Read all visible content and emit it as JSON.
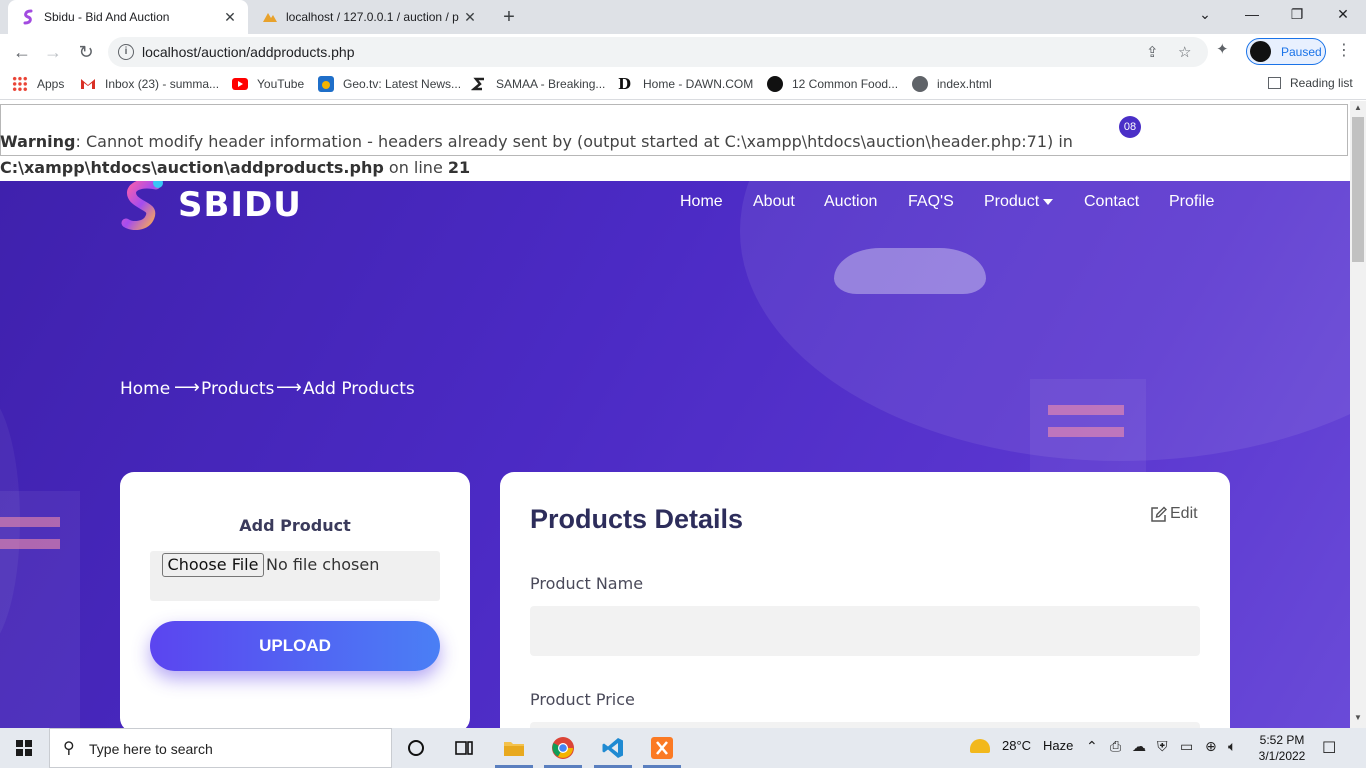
{
  "browser": {
    "tabs": [
      {
        "title": "Sbidu - Bid And Auction",
        "close": "✕"
      },
      {
        "title": "localhost / 127.0.0.1 / auction / p",
        "close": "✕"
      }
    ],
    "new_tab": "+",
    "window_controls": {
      "dropdown": "⌄",
      "minimize": "—",
      "restore": "❐",
      "close": "✕"
    },
    "url": "localhost/auction/addproducts.php",
    "profile_status": "Paused",
    "bookmarks": [
      {
        "label": "Apps"
      },
      {
        "label": "Inbox (23) - summa..."
      },
      {
        "label": "YouTube"
      },
      {
        "label": "Geo.tv: Latest News..."
      },
      {
        "label": "SAMAA - Breaking..."
      },
      {
        "label": "Home - DAWN.COM"
      },
      {
        "label": "12 Common Food..."
      },
      {
        "label": "index.html"
      }
    ],
    "reading_list": "Reading list"
  },
  "warning": {
    "label": "Warning",
    "message": ": Cannot modify header information - headers already sent by (output started at C:\\xampp\\htdocs\\auction\\header.php:71) in ",
    "path": "C:\\xampp\\htdocs\\auction\\addproducts.php",
    "on_line": " on line ",
    "line": "21",
    "badge": "08"
  },
  "site": {
    "logo_text": "SBIDU",
    "nav": [
      "Home",
      "About",
      "Auction",
      "FAQ'S",
      "Product",
      "Contact",
      "Profile"
    ],
    "breadcrumb": [
      "Home",
      "Products",
      "Add Products"
    ],
    "breadcrumb_sep": "⟶"
  },
  "upload_card": {
    "title": "Add Product",
    "choose_file": "Choose File",
    "no_file": "No file chosen",
    "upload_button": "UPLOAD"
  },
  "details_card": {
    "title": "Products Details",
    "edit": "Edit",
    "fields": [
      {
        "label": "Product Name",
        "value": ""
      },
      {
        "label": "Product Price",
        "value": ""
      }
    ]
  },
  "taskbar": {
    "search_placeholder": "Type here to search",
    "temperature": "28°C",
    "weather": "Haze",
    "time": "5:52 PM",
    "date": "3/1/2022"
  },
  "colors": {
    "hero_start": "#3f21ad",
    "hero_end": "#6a4bd8",
    "upload_start": "#5b45f0",
    "upload_end": "#4a7ff5",
    "heading": "#2d2d5b"
  }
}
